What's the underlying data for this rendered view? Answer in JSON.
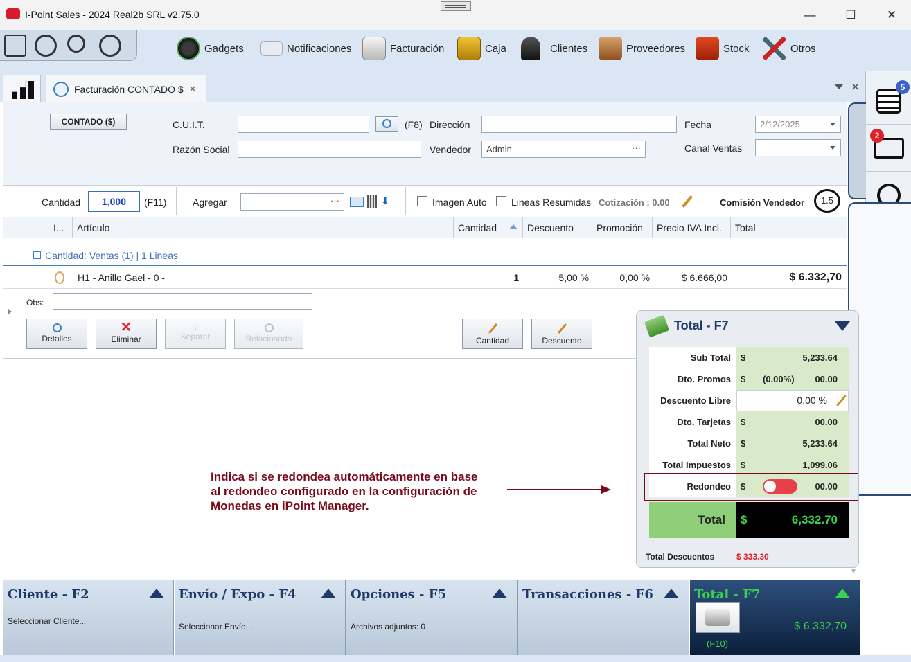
{
  "window": {
    "title": "I-Point Sales  -  2024 Real2b SRL v2.75.0",
    "minimize": "—",
    "maximize": "☐",
    "close": "✕"
  },
  "toolbar": {
    "items": [
      {
        "label": "Gadgets"
      },
      {
        "label": "Notificaciones"
      },
      {
        "label": "Facturación"
      },
      {
        "label": "Caja"
      },
      {
        "label": "Clientes"
      },
      {
        "label": "Proveedores"
      },
      {
        "label": "Stock"
      },
      {
        "label": "Otros"
      }
    ]
  },
  "tab": {
    "label": "Facturación CONTADO $",
    "close": "✕"
  },
  "rail": {
    "tasks_badge": "5",
    "delivery_badge": "2"
  },
  "header": {
    "contado_button": "CONTADO ($)",
    "cuit_label": "C.U.I.T.",
    "cuit_value": "",
    "f8_label": "(F8)",
    "direccion_label": "Dirección",
    "direccion_value": "",
    "fecha_label": "Fecha",
    "fecha_value": "2/12/2025",
    "razon_label": "Razón Social",
    "razon_value": "",
    "vendedor_label": "Vendedor",
    "vendedor_value": "Admin",
    "canal_label": "Canal Ventas",
    "canal_value": ""
  },
  "qtybar": {
    "cantidad_label": "Cantidad",
    "cantidad_value": "1,000",
    "f11_label": "(F11)",
    "agregar_label": "Agregar",
    "imagen_auto": "Imagen Auto",
    "lineas_resumidas": "Lineas Resumidas",
    "cotizacion": "Cotización   : 0.00",
    "comision_label": "Comisión Vendedor",
    "comision_value": "1.5"
  },
  "grid": {
    "columns": [
      "I...",
      "Artículo",
      "Cantidad",
      "Descuento",
      "Promoción",
      "Precio IVA Incl.",
      "Total"
    ],
    "group_label": "Cantidad: Ventas (1) | 1 Lineas",
    "rows": [
      {
        "articulo": "H1 - Anillo Gael - 0 -",
        "cantidad": "1",
        "descuento": "5,00 %",
        "promocion": "0,00 %",
        "precio": "$ 6.666,00",
        "total": "$ 6.332,70"
      }
    ],
    "obs_label": "Obs:",
    "obs_value": "",
    "actions": {
      "detalles": "Detalles",
      "eliminar": "Eliminar",
      "separar": "Separar",
      "relacionado": "Relacionado",
      "cantidad": "Cantidad",
      "descuento": "Descuento"
    }
  },
  "total_panel": {
    "title": "Total - F7",
    "rows": [
      {
        "label": "Sub Total",
        "currency": "$",
        "value": "5,233.64"
      },
      {
        "label": "Dto. Promos",
        "currency": "$",
        "pct": "(0.00%)",
        "value": "00.00"
      },
      {
        "label": "Descuento Libre",
        "value": "0,00 %"
      },
      {
        "label": "Dto. Tarjetas",
        "currency": "$",
        "value": "00.00"
      },
      {
        "label": "Total Neto",
        "currency": "$",
        "value": "5,233.64"
      },
      {
        "label": "Total Impuestos",
        "currency": "$",
        "value": "1,099.06"
      },
      {
        "label": "Redondeo",
        "currency": "$",
        "value": "00.00"
      }
    ],
    "total_label": "Total",
    "total_currency": "$",
    "total_value": "6,332.70",
    "total_descuentos_label": "Total Descuentos",
    "total_descuentos_value": "$ 333.30"
  },
  "annotation": {
    "text_line1": "Indica si se redondea automáticamente en base",
    "text_line2": "al redondeo configurado en la configuración de",
    "text_line3": "Monedas en iPoint Manager."
  },
  "bottom": {
    "cliente_title": "Cliente - F2",
    "cliente_sub": "Seleccionar Cliente...",
    "envio_title": "Envío / Expo - F4",
    "envio_sub": "Seleccionar Envío...",
    "opciones_title": "Opciones - F5",
    "opciones_sub": "Archivos adjuntos: 0",
    "transacciones_title": "Transacciones - F6",
    "total_title": "Total - F7",
    "total_value": "$ 6.332,70",
    "f10_label": "(F10)"
  },
  "colors": {
    "accent_green": "#1fae3a",
    "total_green": "#39d14f",
    "annotation": "#7a0a1a",
    "badge_blue": "#3b63c8",
    "badge_red": "#e0202a"
  }
}
